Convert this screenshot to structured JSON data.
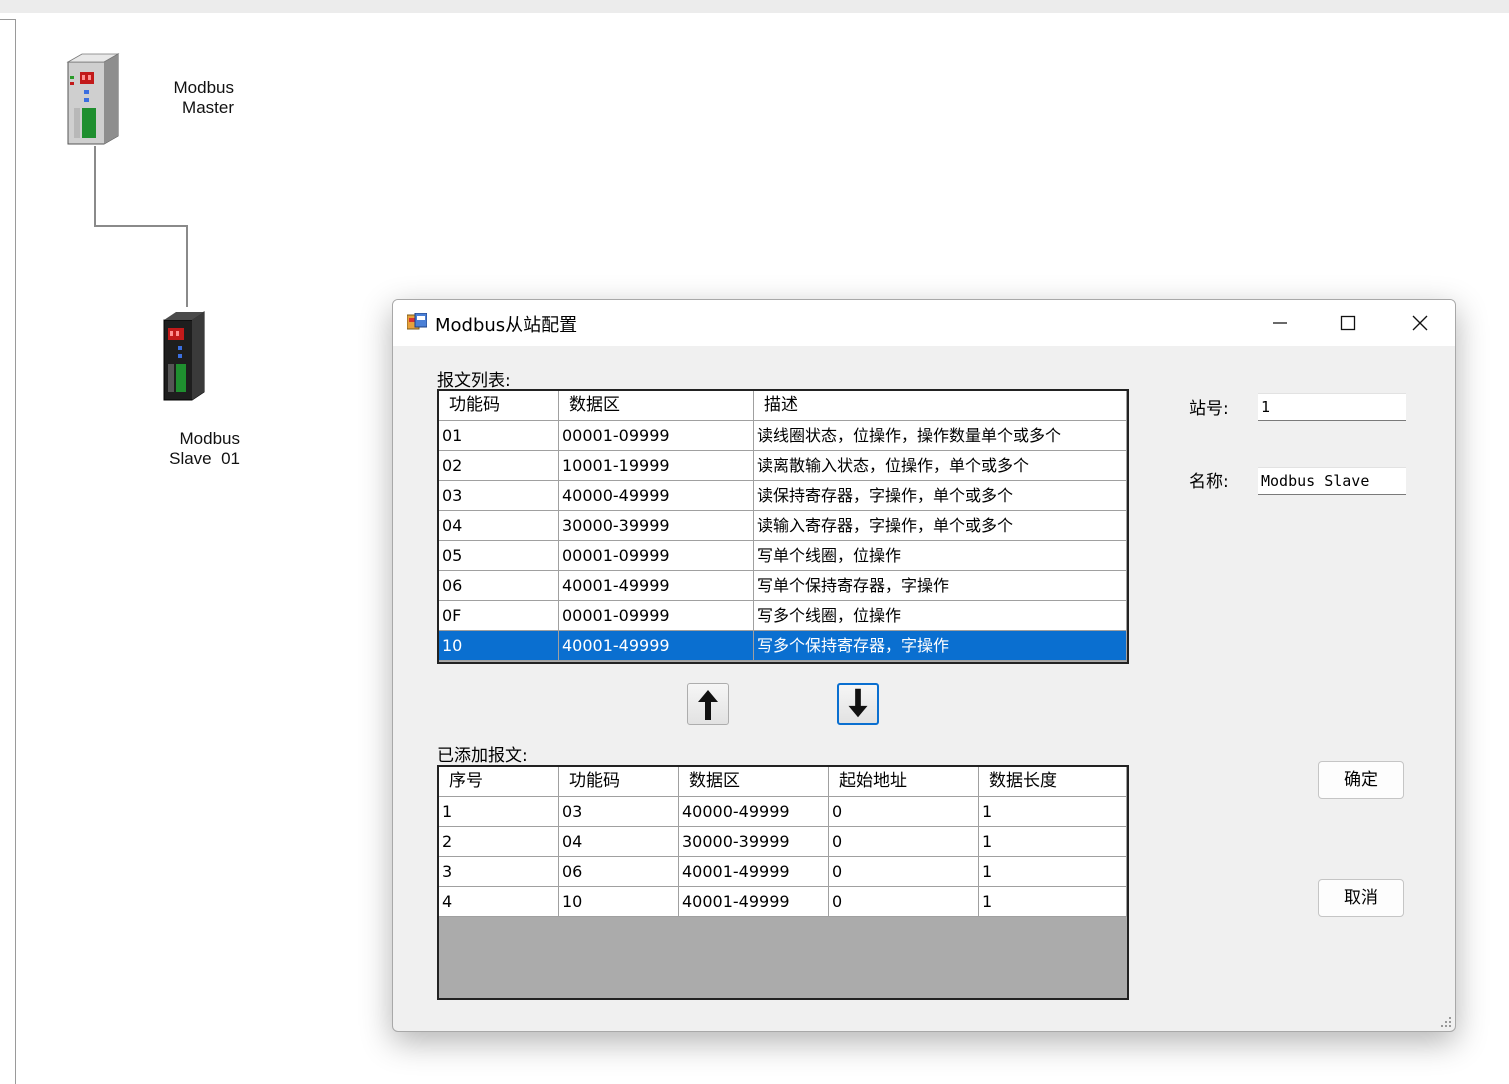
{
  "canvas": {
    "master_label": "Modbus\nMaster",
    "slave_label": "Modbus\nSlave  01"
  },
  "dialog": {
    "title": "Modbus从站配置",
    "minimize": "—",
    "maximize": "☐",
    "close": "✕",
    "message_list_label": "报文列表:",
    "message_list": {
      "columns": [
        "功能码",
        "数据区",
        "描述"
      ],
      "rows": [
        [
          "01",
          "00001-09999",
          "读线圈状态，位操作，操作数量单个或多个"
        ],
        [
          "02",
          "10001-19999",
          "读离散输入状态，位操作，单个或多个"
        ],
        [
          "03",
          "40000-49999",
          "读保持寄存器，字操作，单个或多个"
        ],
        [
          "04",
          "30000-39999",
          "读输入寄存器，字操作，单个或多个"
        ],
        [
          "05",
          "00001-09999",
          "写单个线圈，位操作"
        ],
        [
          "06",
          "40001-49999",
          "写单个保持寄存器，字操作"
        ],
        [
          "0F",
          "00001-09999",
          "写多个线圈，位操作"
        ],
        [
          "10",
          "40001-49999",
          "写多个保持寄存器，字操作"
        ]
      ],
      "selected_row": "10"
    },
    "up_button": "up-arrow",
    "down_button": "down-arrow",
    "added_label": "已添加报文:",
    "added_list": {
      "columns": [
        "序号",
        "功能码",
        "数据区",
        "起始地址",
        "数据长度"
      ],
      "rows": [
        [
          "1",
          "03",
          "40000-49999",
          "0",
          "1"
        ],
        [
          "2",
          "04",
          "30000-39999",
          "0",
          "1"
        ],
        [
          "3",
          "06",
          "40001-49999",
          "0",
          "1"
        ],
        [
          "4",
          "10",
          "40001-49999",
          "0",
          "1"
        ]
      ]
    },
    "station_label": "站号:",
    "station_value": "1",
    "name_label": "名称:",
    "name_value": "Modbus Slave",
    "ok_button": "确定",
    "cancel_button": "取消",
    "colors": {
      "selection": "#0a6fd0",
      "grid_empty": "#ababab"
    }
  }
}
